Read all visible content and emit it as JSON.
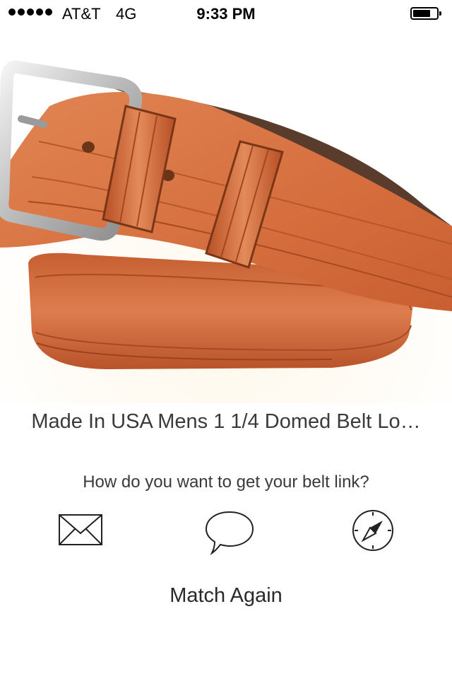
{
  "status_bar": {
    "carrier": "AT&T",
    "network": "4G",
    "time": "9:33 PM",
    "signal_bars": 5
  },
  "product": {
    "title": "Made In USA Mens 1 1/4 Domed Belt Lo…",
    "image": "brown-leather-belt-photo"
  },
  "share": {
    "prompt": "How do you want to get your belt link?",
    "options": [
      {
        "icon": "envelope-icon"
      },
      {
        "icon": "speech-bubble-icon"
      },
      {
        "icon": "compass-icon"
      }
    ]
  },
  "actions": {
    "match_again": "Match Again"
  },
  "colors": {
    "background": "#ffffff",
    "text": "#333333",
    "belt_leather": "#d2703f"
  }
}
